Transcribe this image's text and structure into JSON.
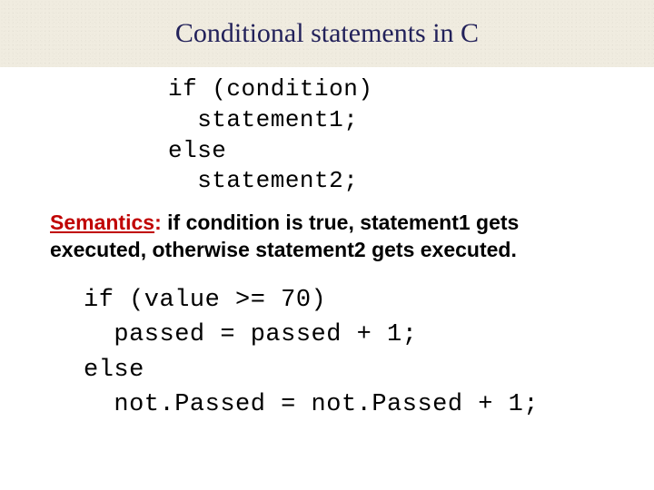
{
  "title": "Conditional statements in C",
  "code1": {
    "l1": "if (condition)",
    "l2": "  statement1;",
    "l3": "else",
    "l4": "  statement2;"
  },
  "semantics": {
    "label": "Semantics",
    "colon": ": ",
    "text": "if condition is true, statement1 gets executed, otherwise statement2 gets executed."
  },
  "code2": {
    "l1": "if (value >= 70)",
    "l2": "  passed = passed + 1;",
    "l3": "else",
    "l4": "  not.Passed = not.Passed + 1;"
  }
}
